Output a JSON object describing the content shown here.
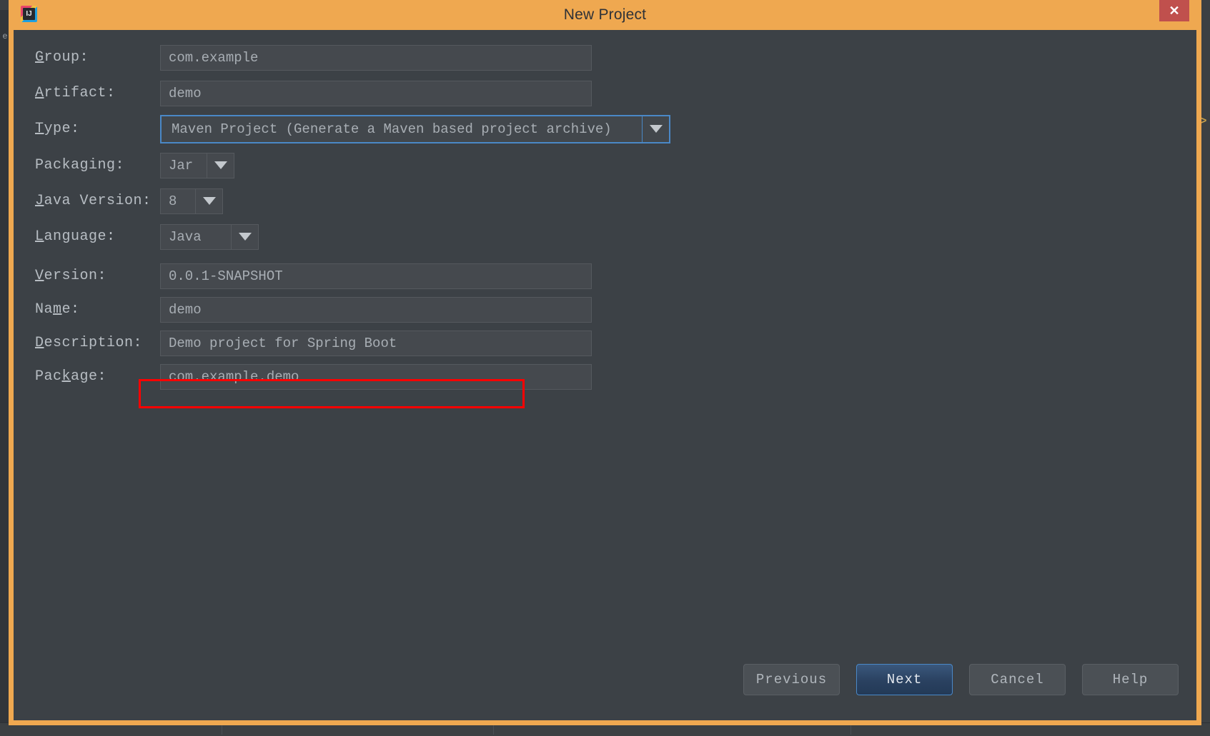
{
  "window": {
    "title": "New Project",
    "app_icon": "intellij-idea-icon",
    "close_label": "✕",
    "accent_border_color": "#efa850",
    "titlebar_color": "#efa850",
    "close_button_color": "#c0504d"
  },
  "form": {
    "fields": [
      {
        "id": "group",
        "label": "Group:",
        "mnemonic": "G",
        "control": "text",
        "value": "com.example"
      },
      {
        "id": "artifact",
        "label": "Artifact:",
        "mnemonic": "A",
        "control": "text",
        "value": "demo"
      },
      {
        "id": "type",
        "label": "Type:",
        "mnemonic": "T",
        "control": "combo",
        "value": "Maven Project (Generate a Maven based project archive)",
        "focused": true,
        "size": "wide"
      },
      {
        "id": "packaging",
        "label": "Packaging:",
        "mnemonic": "",
        "control": "combo",
        "value": "Jar",
        "focused": false,
        "size": "small"
      },
      {
        "id": "java-version",
        "label": "Java Version:",
        "mnemonic": "J",
        "control": "combo",
        "value": "8",
        "focused": false,
        "size": "xsmall"
      },
      {
        "id": "language",
        "label": "Language:",
        "mnemonic": "L",
        "control": "combo",
        "value": "Java",
        "focused": false,
        "size": "medium"
      },
      {
        "id": "version",
        "label": "Version:",
        "mnemonic": "V",
        "control": "text",
        "value": "0.0.1-SNAPSHOT"
      },
      {
        "id": "name",
        "label": "Name:",
        "mnemonic": "m",
        "control": "text",
        "value": "demo"
      },
      {
        "id": "description",
        "label": "Description:",
        "mnemonic": "D",
        "control": "text",
        "value": "Demo project for Spring Boot",
        "annotated": true,
        "annotation_color": "#ff0000"
      },
      {
        "id": "package",
        "label": "Package:",
        "mnemonic": "k",
        "control": "text",
        "value": "com.example.demo"
      }
    ],
    "dropdown_arrow_icon": "chevron-down-icon"
  },
  "buttons": [
    {
      "id": "previous",
      "label": "Previous",
      "primary": false
    },
    {
      "id": "next",
      "label": "Next",
      "primary": true
    },
    {
      "id": "cancel",
      "label": "Cancel",
      "primary": false
    },
    {
      "id": "help",
      "label": "Help",
      "primary": false
    }
  ],
  "backdrop": {
    "side_label": "e"
  }
}
